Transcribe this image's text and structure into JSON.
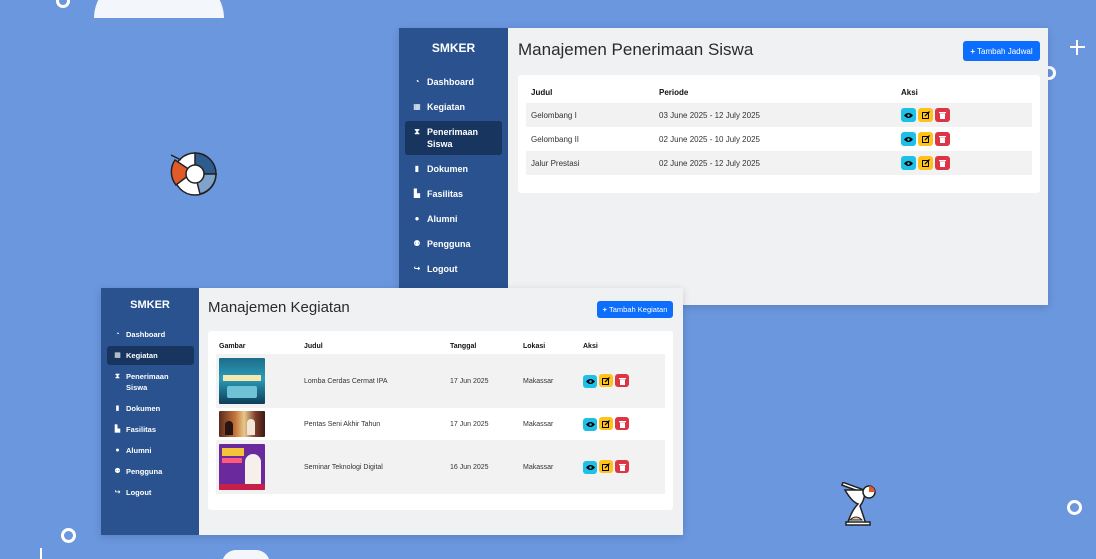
{
  "colors": {
    "background": "#6b97df",
    "sidebar": "#29528f",
    "sidebar_active": "#17355f",
    "primary": "#0d6efd",
    "info": "#1ec0e6",
    "warning": "#ffc21a",
    "danger": "#dc3545"
  },
  "penerimaan_window": {
    "brand": "SMKER",
    "nav": [
      {
        "label": "Dashboard",
        "icon": "gauge-icon"
      },
      {
        "label": "Kegiatan",
        "icon": "calendar-icon"
      },
      {
        "label": "Penerimaan Siswa",
        "icon": "hourglass-icon",
        "active": true
      },
      {
        "label": "Dokumen",
        "icon": "file-icon"
      },
      {
        "label": "Fasilitas",
        "icon": "building-icon"
      },
      {
        "label": "Alumni",
        "icon": "users-icon"
      },
      {
        "label": "Pengguna",
        "icon": "users-cog-icon"
      },
      {
        "label": "Logout",
        "icon": "logout-icon"
      }
    ],
    "title": "Manajemen Penerimaan Siswa",
    "add_button": "Tambah Jadwal",
    "columns": [
      "Judul",
      "Periode",
      "Aksi"
    ],
    "rows": [
      {
        "judul": "Gelombang I",
        "periode": "03 June 2025 - 12 July 2025"
      },
      {
        "judul": "Gelombang II",
        "periode": "02 June 2025 - 10 July 2025"
      },
      {
        "judul": "Jalur Prestasi",
        "periode": "02 June 2025 - 12 July 2025"
      }
    ]
  },
  "kegiatan_window": {
    "brand": "SMKER",
    "nav": [
      {
        "label": "Dashboard",
        "icon": "gauge-icon"
      },
      {
        "label": "Kegiatan",
        "icon": "calendar-icon",
        "active": true
      },
      {
        "label": "Penerimaan Siswa",
        "icon": "hourglass-icon"
      },
      {
        "label": "Dokumen",
        "icon": "file-icon"
      },
      {
        "label": "Fasilitas",
        "icon": "building-icon"
      },
      {
        "label": "Alumni",
        "icon": "users-icon"
      },
      {
        "label": "Pengguna",
        "icon": "users-cog-icon"
      },
      {
        "label": "Logout",
        "icon": "logout-icon"
      }
    ],
    "title": "Manajemen Kegiatan",
    "add_button": "Tambah Kegiatan",
    "columns": [
      "Gambar",
      "Judul",
      "Tanggal",
      "Lokasi",
      "Aksi"
    ],
    "rows": [
      {
        "judul": "Lomba Cerdas Cermat IPA",
        "tanggal": "17 Jun 2025",
        "lokasi": "Makassar",
        "thumb": "quiz-poster-image"
      },
      {
        "judul": "Pentas Seni Akhir Tahun",
        "tanggal": "17 Jun 2025",
        "lokasi": "Makassar",
        "thumb": "art-show-photo"
      },
      {
        "judul": "Seminar Teknologi Digital",
        "tanggal": "16 Jun 2025",
        "lokasi": "Makassar",
        "thumb": "seminar-poster-image"
      }
    ]
  }
}
